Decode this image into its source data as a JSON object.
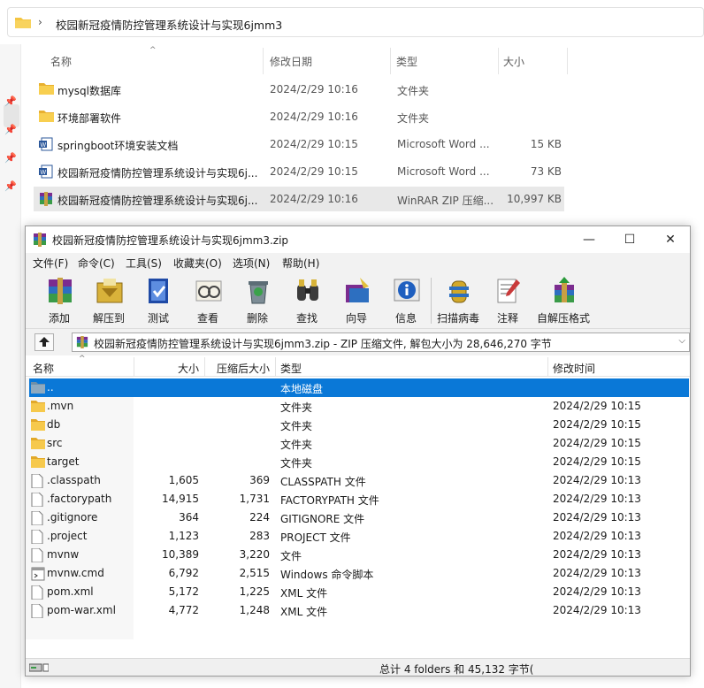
{
  "explorer": {
    "breadcrumb": "校园新冠疫情防控管理系统设计与实现6jmm3",
    "columns": {
      "name": "名称",
      "date": "修改日期",
      "type": "类型",
      "size": "大小"
    },
    "rows": [
      {
        "name": "mysql数据库",
        "date": "2024/2/29 10:16",
        "type": "文件夹",
        "size": "",
        "icon": "folder-icon"
      },
      {
        "name": "环境部署软件",
        "date": "2024/2/29 10:16",
        "type": "文件夹",
        "size": "",
        "icon": "folder-icon"
      },
      {
        "name": "springboot环境安装文档",
        "date": "2024/2/29 10:15",
        "type": "Microsoft Word ...",
        "size": "15 KB",
        "icon": "word-document-icon"
      },
      {
        "name": "校园新冠疫情防控管理系统设计与实现6j...",
        "date": "2024/2/29 10:15",
        "type": "Microsoft Word ...",
        "size": "73 KB",
        "icon": "word-document-icon"
      },
      {
        "name": "校园新冠疫情防控管理系统设计与实现6j...",
        "date": "2024/2/29 10:16",
        "type": "WinRAR ZIP 压缩...",
        "size": "10,997 KB",
        "icon": "winrar-archive-icon"
      }
    ]
  },
  "winrar": {
    "title": "校园新冠疫情防控管理系统设计与实现6jmm3.zip",
    "window_buttons": {
      "minimize": "—",
      "maximize": "☐",
      "close": "✕"
    },
    "menu": [
      "文件(F)",
      "命令(C)",
      "工具(S)",
      "收藏夹(O)",
      "选项(N)",
      "帮助(H)"
    ],
    "toolbar": [
      {
        "label": "添加",
        "icon": "add-archive-icon"
      },
      {
        "label": "解压到",
        "icon": "extract-to-icon"
      },
      {
        "label": "测试",
        "icon": "test-icon"
      },
      {
        "label": "查看",
        "icon": "view-icon"
      },
      {
        "label": "删除",
        "icon": "delete-icon"
      },
      {
        "label": "查找",
        "icon": "find-icon"
      },
      {
        "label": "向导",
        "icon": "wizard-icon"
      },
      {
        "label": "信息",
        "icon": "info-icon"
      },
      {
        "label": "扫描病毒",
        "icon": "virus-scan-icon"
      },
      {
        "label": "注释",
        "icon": "comment-icon"
      },
      {
        "label": "自解压格式",
        "icon": "sfx-icon"
      }
    ],
    "path_text": "校园新冠疫情防控管理系统设计与实现6jmm3.zip - ZIP 压缩文件, 解包大小为 28,646,270 字节",
    "columns": {
      "name": "名称",
      "size": "大小",
      "packed": "压缩后大小",
      "type": "类型",
      "modified": "修改时间"
    },
    "rows": [
      {
        "name": "..",
        "size": "",
        "packed": "",
        "type": "本地磁盘",
        "modified": "",
        "icon": "parent-folder-icon"
      },
      {
        "name": ".mvn",
        "size": "",
        "packed": "",
        "type": "文件夹",
        "modified": "2024/2/29 10:15",
        "icon": "folder-icon"
      },
      {
        "name": "db",
        "size": "",
        "packed": "",
        "type": "文件夹",
        "modified": "2024/2/29 10:15",
        "icon": "folder-icon"
      },
      {
        "name": "src",
        "size": "",
        "packed": "",
        "type": "文件夹",
        "modified": "2024/2/29 10:15",
        "icon": "folder-icon"
      },
      {
        "name": "target",
        "size": "",
        "packed": "",
        "type": "文件夹",
        "modified": "2024/2/29 10:15",
        "icon": "folder-icon"
      },
      {
        "name": ".classpath",
        "size": "1,605",
        "packed": "369",
        "type": "CLASSPATH 文件",
        "modified": "2024/2/29 10:13",
        "icon": "file-icon"
      },
      {
        "name": ".factorypath",
        "size": "14,915",
        "packed": "1,731",
        "type": "FACTORYPATH 文件",
        "modified": "2024/2/29 10:13",
        "icon": "file-icon"
      },
      {
        "name": ".gitignore",
        "size": "364",
        "packed": "224",
        "type": "GITIGNORE 文件",
        "modified": "2024/2/29 10:13",
        "icon": "file-icon"
      },
      {
        "name": ".project",
        "size": "1,123",
        "packed": "283",
        "type": "PROJECT 文件",
        "modified": "2024/2/29 10:13",
        "icon": "file-icon"
      },
      {
        "name": "mvnw",
        "size": "10,389",
        "packed": "3,220",
        "type": "文件",
        "modified": "2024/2/29 10:13",
        "icon": "file-icon"
      },
      {
        "name": "mvnw.cmd",
        "size": "6,792",
        "packed": "2,515",
        "type": "Windows 命令脚本",
        "modified": "2024/2/29 10:13",
        "icon": "cmd-script-icon"
      },
      {
        "name": "pom.xml",
        "size": "5,172",
        "packed": "1,225",
        "type": "XML 文件",
        "modified": "2024/2/29 10:13",
        "icon": "file-icon"
      },
      {
        "name": "pom-war.xml",
        "size": "4,772",
        "packed": "1,248",
        "type": "XML 文件",
        "modified": "2024/2/29 10:13",
        "icon": "file-icon"
      }
    ],
    "status": "总计 4 folders 和 45,132 字节("
  },
  "colors": {
    "selection": "#0a78d7",
    "folder": "#f4c542",
    "chrome": "#f2f2f2"
  }
}
